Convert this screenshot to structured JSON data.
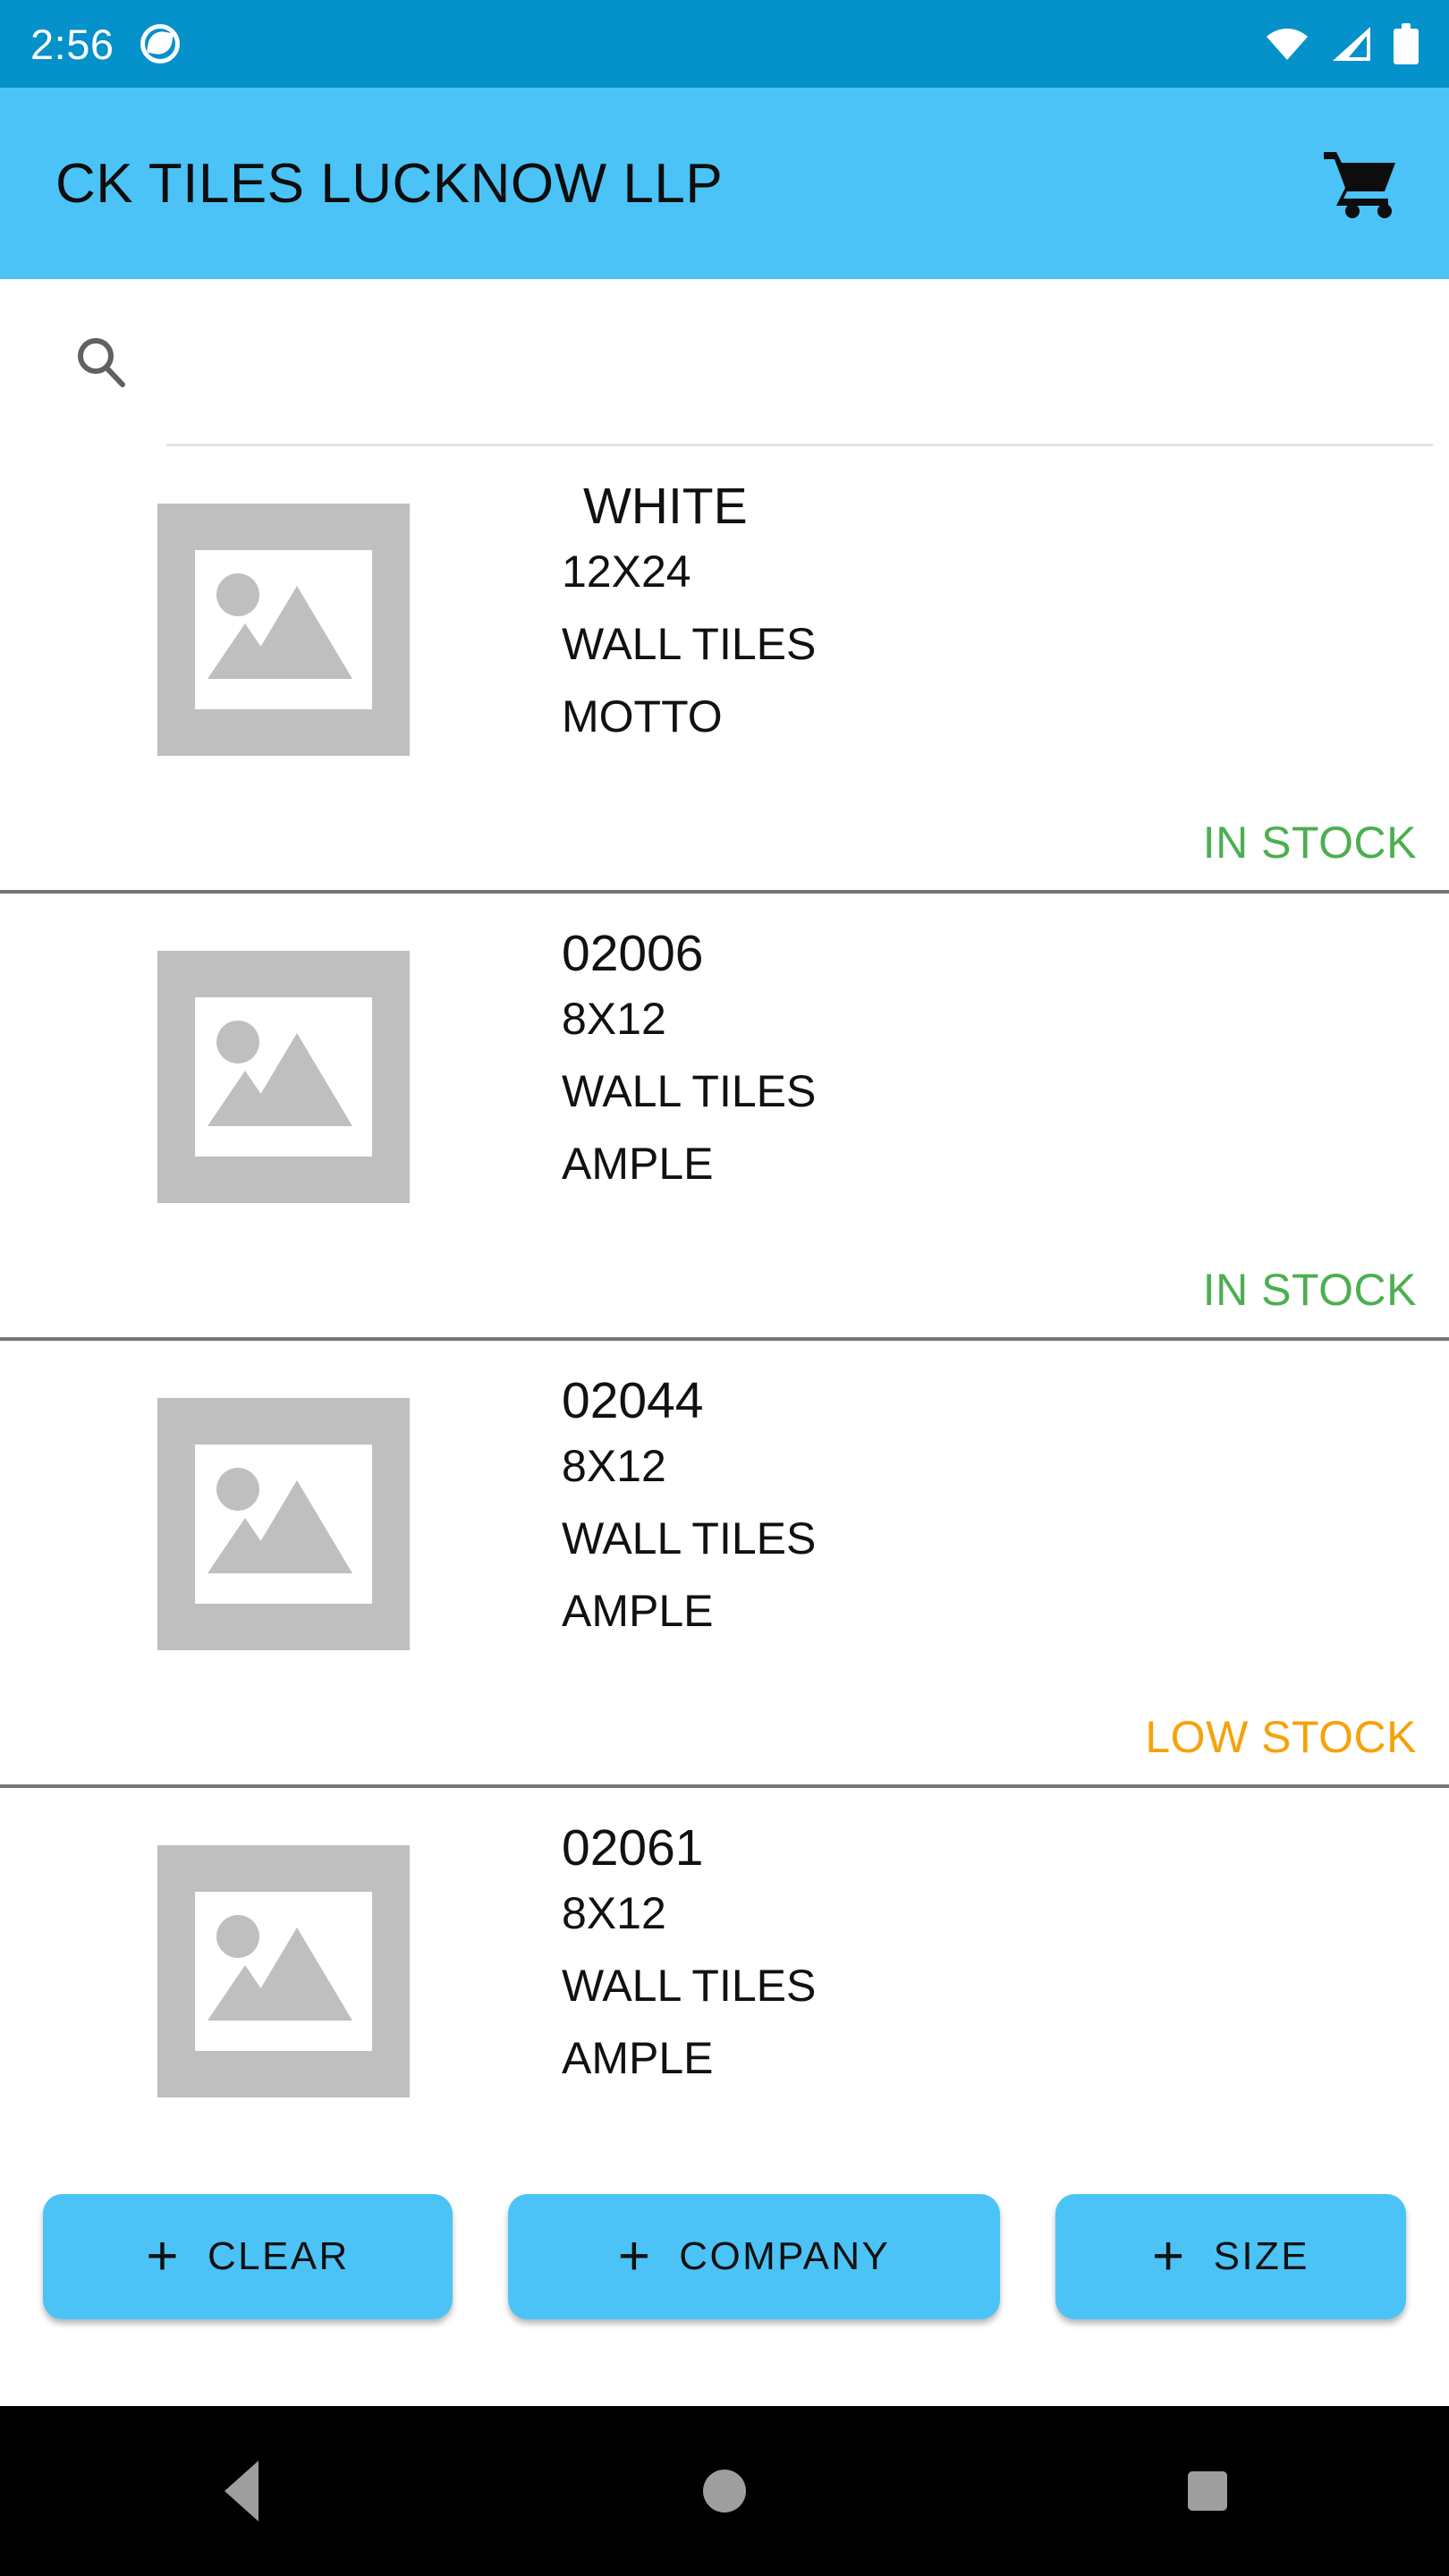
{
  "status_bar": {
    "time": "2:56",
    "app_notification_icon": "capture-app-icon",
    "wifi_icon": "wifi-icon",
    "signal_icon": "cellular-signal-icon",
    "battery_icon": "battery-full-icon",
    "background_color": "#0591c9"
  },
  "app_bar": {
    "title": "CK TILES LUCKNOW LLP",
    "cart_icon": "shopping-cart-icon",
    "background_color": "#4cc3f7",
    "title_color": "#0d0d0d"
  },
  "search": {
    "icon": "search-icon",
    "value": "",
    "placeholder": ""
  },
  "products": [
    {
      "name": "WHITE",
      "size": "12X24",
      "category": "WALL TILES",
      "company": "MOTTO",
      "stock_label": "IN STOCK",
      "stock_state": "in",
      "image": "image-placeholder-icon"
    },
    {
      "name": "02006",
      "size": "8X12",
      "category": "WALL TILES",
      "company": "AMPLE",
      "stock_label": "IN STOCK",
      "stock_state": "in",
      "image": "image-placeholder-icon"
    },
    {
      "name": "02044",
      "size": "8X12",
      "category": "WALL TILES",
      "company": "AMPLE",
      "stock_label": "LOW STOCK",
      "stock_state": "low",
      "image": "image-placeholder-icon"
    },
    {
      "name": "02061",
      "size": "8X12",
      "category": "WALL TILES",
      "company": "AMPLE",
      "stock_label": "",
      "stock_state": "none",
      "image": "image-placeholder-icon"
    }
  ],
  "actions": {
    "plus": "+",
    "clear_label": "CLEAR",
    "company_label": "COMPANY",
    "size_label": "SIZE",
    "background_color": "#4cc3f7"
  },
  "nav_bar": {
    "back_icon": "back-triangle-icon",
    "home_icon": "home-circle-icon",
    "recents_icon": "recents-square-icon",
    "background_color": "#000000"
  },
  "colors": {
    "in_stock": "#4caf50",
    "low_stock": "#f5a20c",
    "divider": "#757575",
    "placeholder_gray": "#bfbfbf"
  }
}
